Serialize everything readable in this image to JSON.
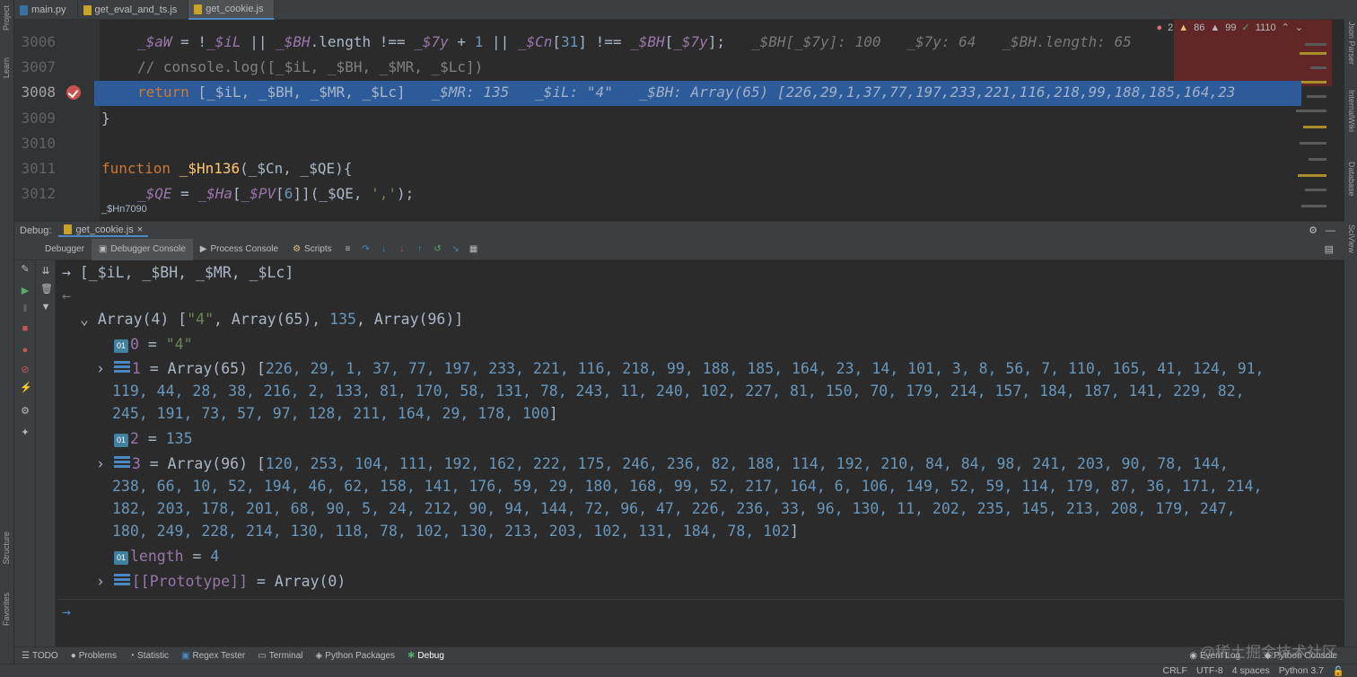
{
  "tabs": [
    {
      "label": "main.py",
      "icon": "python-file-icon",
      "color": "#3572a5"
    },
    {
      "label": "get_eval_and_ts.js",
      "icon": "js-file-icon",
      "color": "#c9a227"
    },
    {
      "label": "get_cookie.js",
      "icon": "js-file-icon",
      "color": "#c9a227",
      "active": true
    }
  ],
  "editor": {
    "lines": [
      {
        "num": "3006"
      },
      {
        "num": "3007"
      },
      {
        "num": "3008"
      },
      {
        "num": "3009"
      },
      {
        "num": "3010"
      },
      {
        "num": "3011"
      },
      {
        "num": "3012"
      }
    ],
    "code": {
      "l3006_a": "_$aW",
      "l3006_b": " = !",
      "l3006_c": "_$iL",
      "l3006_d": " || ",
      "l3006_e": "_$BH",
      "l3006_f": ".length !== ",
      "l3006_g": "_$7y",
      "l3006_h": " + ",
      "l3006_i": "1",
      "l3006_j": " || ",
      "l3006_k": "_$Cn",
      "l3006_l": "[",
      "l3006_m": "31",
      "l3006_n": "] !== ",
      "l3006_o": "_$BH",
      "l3006_p": "[",
      "l3006_q": "_$7y",
      "l3006_r": "];",
      "l3006_hint": "_$BH[_$7y]: 100   _$7y: 64   _$BH.length: 65",
      "l3007": "// console.log([_$iL, _$BH, _$MR, _$Lc])",
      "l3008_kw": "return",
      "l3008_body": " [_$iL, _$BH, _$MR, _$Lc]",
      "l3008_hint": "_$MR: 135   _$iL: \"4\"   _$BH: Array(65) [226,29,1,37,77,197,233,221,116,218,99,188,185,164,23",
      "l3009": "}",
      "l3011_kw": "function",
      "l3011_fn": " _$Hn136",
      "l3011_rest": "(_$Cn, _$QE){",
      "l3012_a": "_$QE",
      "l3012_b": " = ",
      "l3012_c": "_$Ha",
      "l3012_d": "[",
      "l3012_e": "_$PV",
      "l3012_f": "[",
      "l3012_g": "6",
      "l3012_h": "]](_$QE, ",
      "l3012_i": "','",
      "l3012_j": ");"
    },
    "breadcrumb": "_$Hn7090"
  },
  "inspections": {
    "errors": "2",
    "warnings": "86",
    "weak": "99",
    "ok": "1110"
  },
  "debug": {
    "label": "Debug:",
    "session": "get_cookie.js",
    "tabs": [
      {
        "label": "Debugger"
      },
      {
        "label": "Debugger Console",
        "active": true
      },
      {
        "label": "Process Console"
      },
      {
        "label": "Scripts"
      }
    ]
  },
  "console": {
    "input": "[_$iL, _$BH, _$MR, _$Lc]",
    "result_header_a": "Array(4) [",
    "result_header_b": "\"4\"",
    "result_header_c": ", Array(65), ",
    "result_header_d": "135",
    "result_header_e": ", Array(96)]",
    "item0_key": "0",
    "item0_val": "\"4\"",
    "item1_key": "1",
    "item1_head": "Array(65) [",
    "item1_line1": "226, 29, 1, 37, 77, 197, 233, 221, 116, 218, 99, 188, 185, 164, 23, 14, 101, 3, 8, 56, 7, 110, 165, 41, 124, 91,",
    "item1_line2": "119, 44, 28, 38, 216, 2, 133, 81, 170, 58, 131, 78, 243, 11, 240, 102, 227, 81, 150, 70, 179, 214, 157, 184, 187, 141, 229, 82,",
    "item1_line3": "245, 191, 73, 57, 97, 128, 211, 164, 29, 178, 100",
    "item2_key": "2",
    "item2_val": "135",
    "item3_key": "3",
    "item3_head": "Array(96) [",
    "item3_line1": "120, 253, 104, 111, 192, 162, 222, 175, 246, 236, 82, 188, 114, 192, 210, 84, 84, 98, 241, 203, 90, 78, 144,",
    "item3_line2": "238, 66, 10, 52, 194, 46, 62, 158, 141, 176, 59, 29, 180, 168, 99, 52, 217, 164, 6, 106, 149, 52, 59, 114, 179, 87, 36, 171, 214,",
    "item3_line3": "182, 203, 178, 201, 68, 90, 5, 24, 212, 90, 94, 144, 72, 96, 47, 226, 236, 33, 96, 130, 11, 202, 235, 145, 213, 208, 179, 247,",
    "item3_line4": "180, 249, 228, 214, 130, 118, 78, 102, 130, 213, 203, 102, 131, 184, 78, 102",
    "length_key": "length",
    "length_val": "4",
    "proto_key": "[[Prototype]]",
    "proto_val": "Array(0)"
  },
  "bottom_tools": [
    {
      "label": "TODO"
    },
    {
      "label": "Problems"
    },
    {
      "label": "Statistic"
    },
    {
      "label": "Regex Tester"
    },
    {
      "label": "Terminal"
    },
    {
      "label": "Python Packages"
    },
    {
      "label": "Debug",
      "active": true
    }
  ],
  "bottom_right": {
    "event_log": "Event Log",
    "python_console": "Python Console"
  },
  "status": {
    "line_sep": "CRLF",
    "encoding": "UTF-8",
    "indent": "4 spaces",
    "interpreter": "Python 3.7"
  },
  "side_labels": {
    "project": "Project",
    "learn": "Learn",
    "structure": "Structure",
    "favorites": "Favorites",
    "json_parser": "Json Parser",
    "internal_wiki": "InternalWiki",
    "database": "Database",
    "sciview": "SciView"
  },
  "watermark": "@稀土掘金技术社区"
}
